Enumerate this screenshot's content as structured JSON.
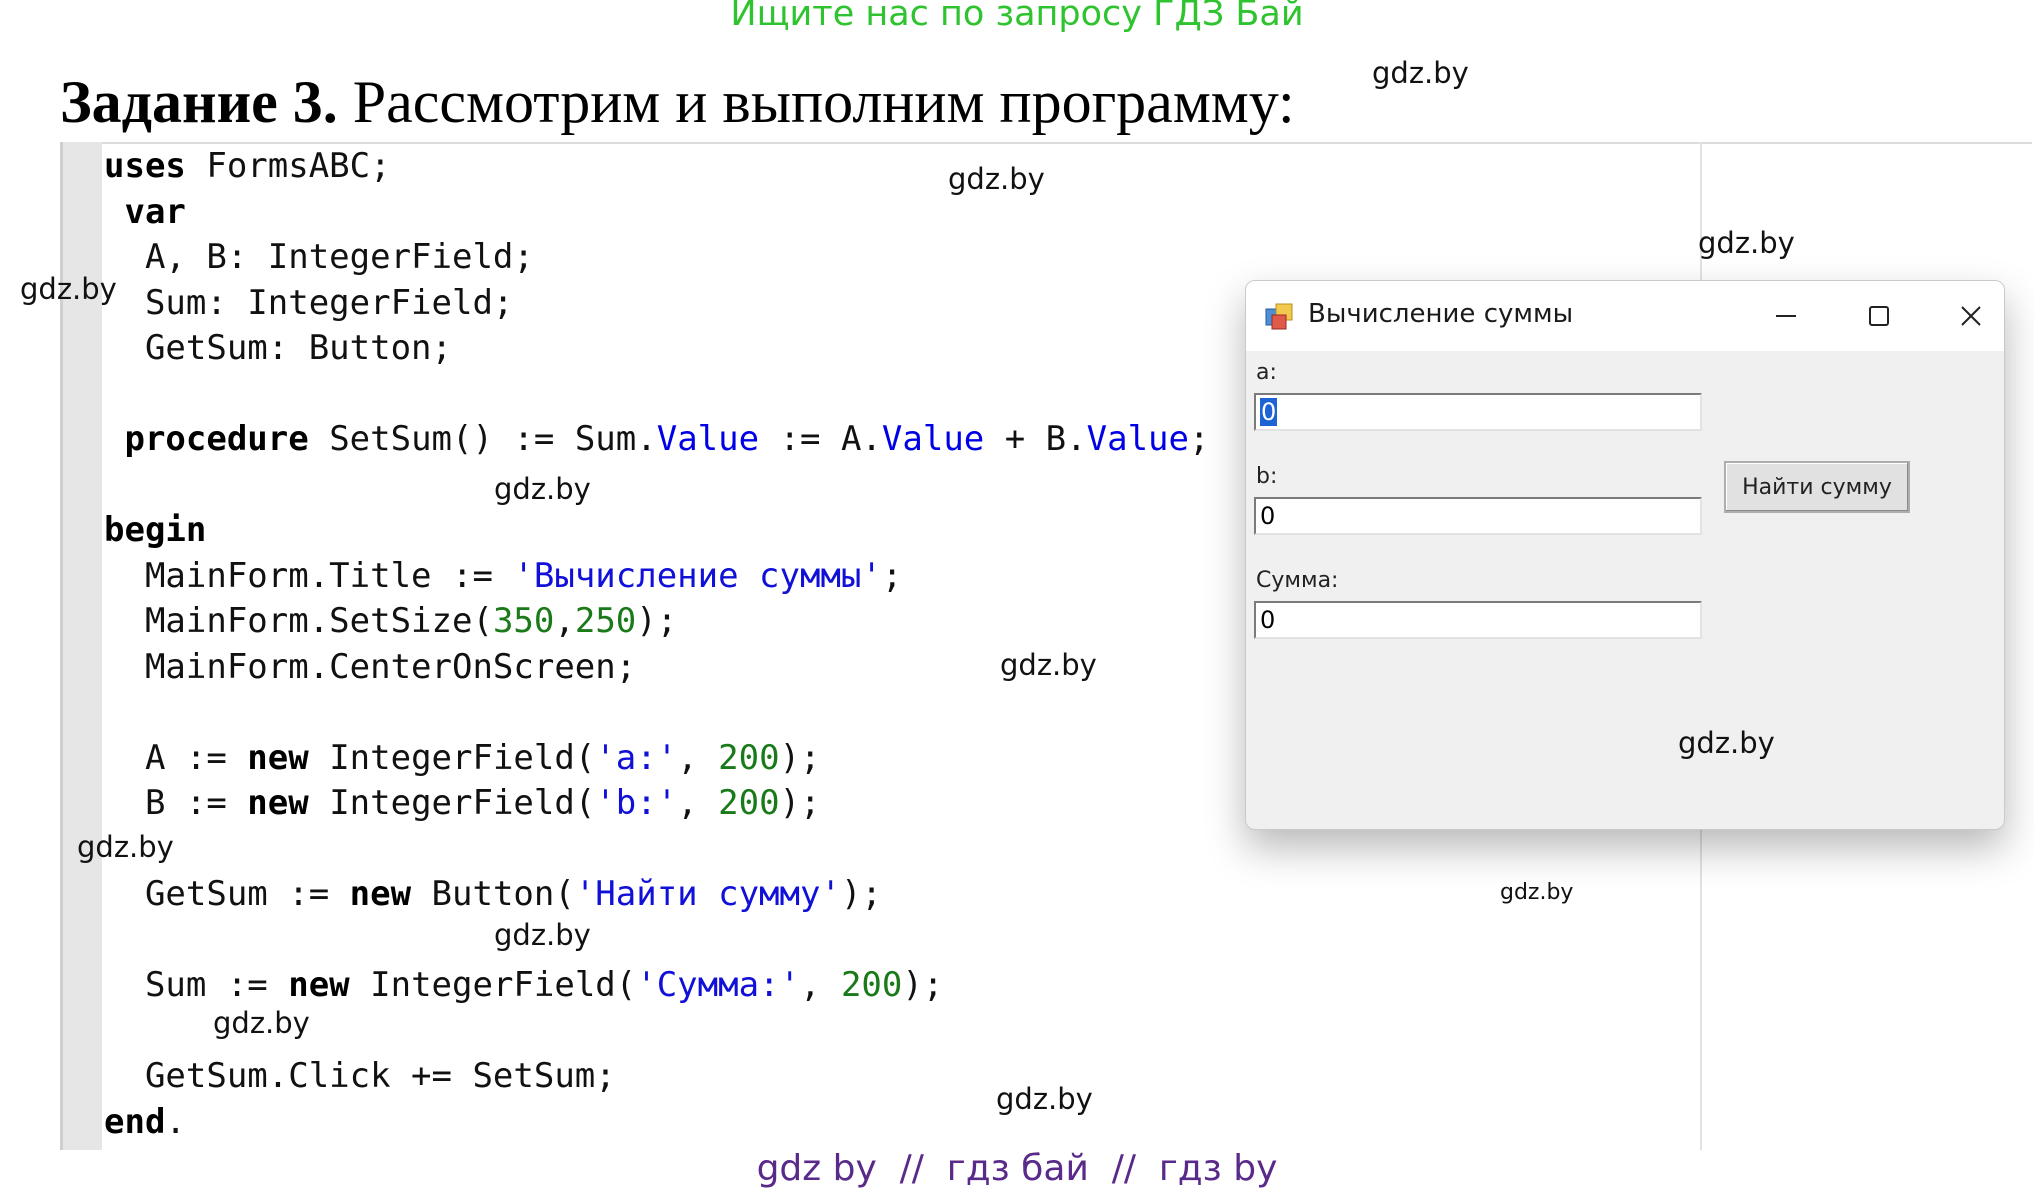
{
  "banner": "Ищите нас по запросу ГДЗ Бай",
  "heading": {
    "bold": "Задание 3.",
    "text": " Рассмотрим и выполним программу:"
  },
  "code_lines": [
    "uses FormsABC;",
    " var",
    "  A, B: IntegerField;",
    "  Sum: IntegerField;",
    "  GetSum: Button;",
    "",
    " procedure SetSum() := Sum.Value := A.Value + B.Value;",
    "",
    "begin",
    "  MainForm.Title := 'Вычисление суммы';",
    "  MainForm.SetSize(350,250);",
    "  MainForm.CenterOnScreen;",
    "",
    "  A := new IntegerField('a:', 200);",
    "  B := new IntegerField('b:', 200);",
    "",
    "  GetSum := new Button('Найти сумму');",
    "",
    "  Sum := new IntegerField('Сумма:', 200);",
    "",
    "  GetSum.Click += SetSum;",
    "end."
  ],
  "window": {
    "title": "Вычисление суммы",
    "app_icon": "winforms-app-icon",
    "controls": [
      "minimize-icon",
      "maximize-icon",
      "close-icon"
    ],
    "field_a": {
      "label": "a:",
      "value": "0"
    },
    "field_b": {
      "label": "b:",
      "value": "0"
    },
    "field_sum": {
      "label": "Сумма:",
      "value": "0"
    },
    "button_label": "Найти сумму"
  },
  "watermark": "gdz.by",
  "footer": "gdz by  //  гдз бай  //  гдз by",
  "colors": {
    "banner": "#2fc42f",
    "keyword": "#000000",
    "property": "#0000e6",
    "string": "#1010d8",
    "number": "#1a7a1a",
    "footer": "#5a2a8a",
    "selection": "#1e63d6"
  }
}
